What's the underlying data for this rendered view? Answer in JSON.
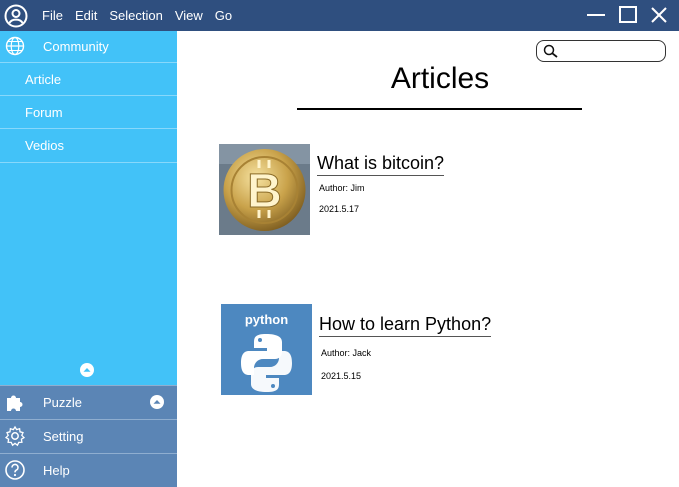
{
  "menu": [
    "File",
    "Edit",
    "Selection",
    "View",
    "Go"
  ],
  "sidebar": {
    "header": "Community",
    "items": [
      "Article",
      "Forum",
      "Vedios"
    ],
    "bottom": [
      "Puzzle",
      "Setting",
      "Help"
    ]
  },
  "main": {
    "title": "Articles",
    "articles": [
      {
        "title": "What is bitcoin?",
        "author": "Author: Jim",
        "date": "2021.5.17",
        "image_label": ""
      },
      {
        "title": "How to learn Python?",
        "author": "Author: Jack",
        "date": "2021.5.15",
        "image_label": "python"
      }
    ]
  },
  "colors": {
    "titlebar": "#2f4f7f",
    "sidebar": "#42c2f8",
    "sidebar_bottom": "#5b85b5"
  }
}
